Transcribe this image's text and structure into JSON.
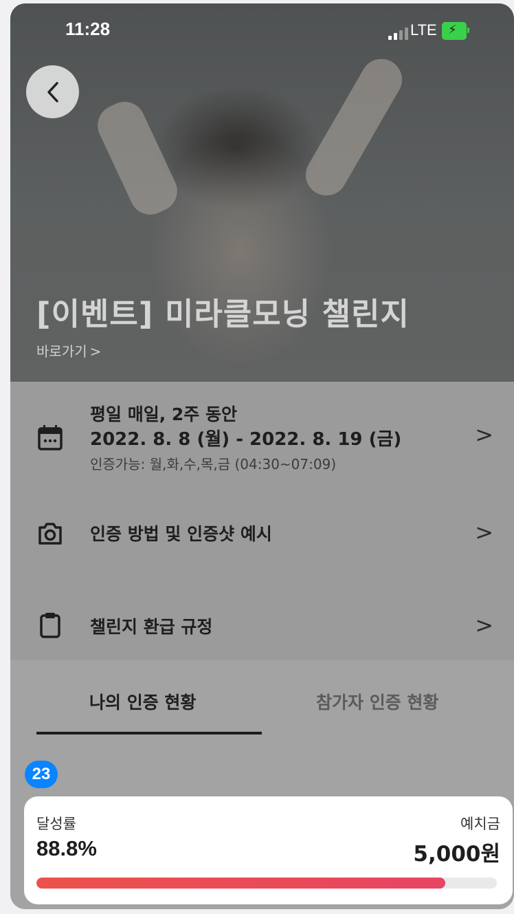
{
  "status_bar": {
    "time": "11:28",
    "network": "LTE"
  },
  "hero": {
    "title": "[이벤트] 미라클모닝 챌린지",
    "shortcut_label": "바로가기"
  },
  "info_rows": {
    "schedule": {
      "title": "평일 매일, 2주 동안",
      "dates": "2022. 8. 8 (월) - 2022. 8. 19 (금)",
      "available": "인증가능: 월,화,수,목,금 (04:30~07:09)",
      "icon": "calendar-icon"
    },
    "method": {
      "label": "인증 방법 및 인증샷 예시",
      "icon": "camera-icon"
    },
    "refund": {
      "label": "챌린지 환급 규정",
      "icon": "clipboard-icon"
    }
  },
  "tabs": [
    {
      "label": "나의 인증 현황",
      "active": true
    },
    {
      "label": "참가자 인증 현황",
      "active": false
    }
  ],
  "badge": "23",
  "progress": {
    "rate_label": "달성률",
    "rate_value": "88.8%",
    "rate_fraction": 0.888,
    "deposit_label": "예치금",
    "deposit_value": "5,000원"
  },
  "colors": {
    "accent": "#e64563",
    "badge": "#0a84ff",
    "battery": "#39d14a"
  }
}
